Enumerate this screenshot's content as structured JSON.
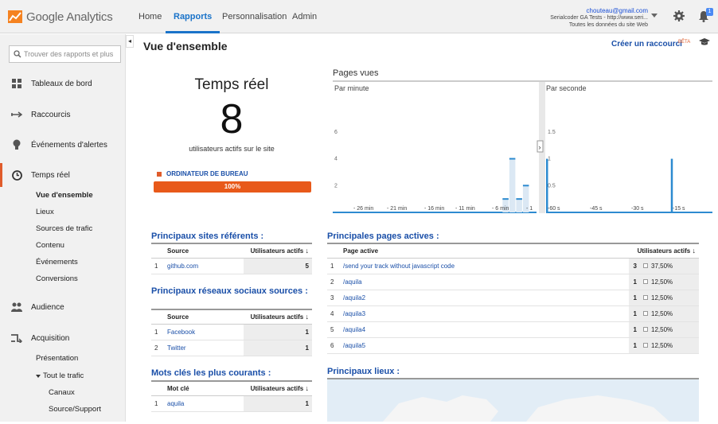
{
  "app": {
    "brand": "Google Analytics"
  },
  "nav": {
    "home": "Home",
    "reports": "Rapports",
    "custom": "Personnalisation",
    "admin": "Admin"
  },
  "account": {
    "email": "chouteau@gmail.com",
    "property": "Serialcoder GA Tests - http://www.seri...",
    "view": "Toutes les données du site Web",
    "badge": "1"
  },
  "sidebar": {
    "search_placeholder": "Trouver des rapports et plus",
    "items": [
      {
        "label": "Tableaux de bord",
        "icon": "dashboard-icon"
      },
      {
        "label": "Raccourcis",
        "icon": "shortcut-arrow-icon"
      },
      {
        "label": "Événements d'alertes",
        "icon": "lightbulb-icon"
      },
      {
        "label": "Temps réel",
        "icon": "clock-icon"
      },
      {
        "label": "Audience",
        "icon": "people-icon"
      },
      {
        "label": "Acquisition",
        "icon": "acquisition-arrows-icon"
      }
    ],
    "realtime_subitems": [
      "Vue d'ensemble",
      "Lieux",
      "Sources de trafic",
      "Contenu",
      "Événements",
      "Conversions"
    ],
    "acquisition_subitems": [
      "Présentation",
      "Tout le trafic",
      "Canaux",
      "Source/Support"
    ]
  },
  "main": {
    "title": "Vue d'ensemble",
    "shortcut": "Créer un raccourci",
    "beta": "BÊTA",
    "realtime": {
      "title": "Temps réel",
      "count": "8",
      "subtitle": "utilisateurs actifs sur le site",
      "device": "ORDINATEUR DE BUREAU",
      "device_pct": "100%",
      "device_fill": 1.0
    },
    "pageviews": {
      "title": "Pages vues",
      "per_minute": "Par minute",
      "per_second": "Par seconde"
    }
  },
  "chart_data": [
    {
      "type": "bar",
      "title": "Par minute",
      "y_ticks": [
        "2",
        "4",
        "6"
      ],
      "x_ticks": [
        "- 26 min",
        "- 21 min",
        "- 16 min",
        "- 11 min",
        "- 6 min",
        "- 1"
      ],
      "ylim": [
        0,
        7
      ],
      "values": [
        0,
        0,
        0,
        0,
        0,
        0,
        0,
        0,
        0,
        0,
        0,
        0,
        0,
        0,
        0,
        0,
        0,
        0,
        0,
        0,
        0,
        0,
        0,
        0,
        0,
        1,
        4,
        1,
        2,
        0
      ]
    },
    {
      "type": "bar",
      "title": "Par seconde",
      "y_ticks": [
        "0.5",
        "1",
        "1.5"
      ],
      "x_ticks": [
        "-60 s",
        "-45 s",
        "-30 s",
        "-15 s"
      ],
      "ylim": [
        0,
        1.75
      ],
      "values": [
        1,
        0,
        0,
        0,
        0,
        0,
        0,
        0,
        0,
        0,
        0,
        0,
        0,
        0,
        0,
        0,
        0,
        0,
        0,
        0,
        0,
        0,
        0,
        0,
        0,
        0,
        0,
        0,
        0,
        0,
        0,
        0,
        0,
        0,
        0,
        0,
        0,
        0,
        0,
        0,
        0,
        0,
        0,
        0,
        0,
        1,
        0,
        0,
        0,
        0,
        0,
        0,
        0,
        0,
        0,
        0,
        0,
        0,
        0,
        0
      ]
    }
  ],
  "referrers": {
    "title": "Principaux sites référents :",
    "col_source": "Source",
    "col_users": "Utilisateurs actifs",
    "rows": [
      {
        "n": "1",
        "name": "github.com",
        "v": "5"
      }
    ]
  },
  "social": {
    "title": "Principaux réseaux sociaux sources :",
    "col_source": "Source",
    "col_users": "Utilisateurs actifs",
    "rows": [
      {
        "n": "1",
        "name": "Facebook",
        "v": "1"
      },
      {
        "n": "2",
        "name": "Twitter",
        "v": "1"
      }
    ]
  },
  "keywords": {
    "title": "Mots clés les plus courants :",
    "col_kw": "Mot clé",
    "col_users": "Utilisateurs actifs",
    "rows": [
      {
        "n": "1",
        "name": "aquila",
        "v": "1"
      }
    ]
  },
  "pages": {
    "title": "Principales pages actives :",
    "col_page": "Page active",
    "col_users": "Utilisateurs actifs",
    "rows": [
      {
        "n": "1",
        "name": "/send your track without javascript code",
        "v": "3",
        "pct": "37,50%",
        "frac": 0.375
      },
      {
        "n": "2",
        "name": "/aquila",
        "v": "1",
        "pct": "12,50%",
        "frac": 0.125
      },
      {
        "n": "3",
        "name": "/aquila2",
        "v": "1",
        "pct": "12,50%",
        "frac": 0.125
      },
      {
        "n": "4",
        "name": "/aquila3",
        "v": "1",
        "pct": "12,50%",
        "frac": 0.125
      },
      {
        "n": "5",
        "name": "/aquila4",
        "v": "1",
        "pct": "12,50%",
        "frac": 0.125
      },
      {
        "n": "6",
        "name": "/aquila5",
        "v": "1",
        "pct": "12,50%",
        "frac": 0.125
      }
    ]
  },
  "locations": {
    "title": "Principaux lieux :"
  }
}
